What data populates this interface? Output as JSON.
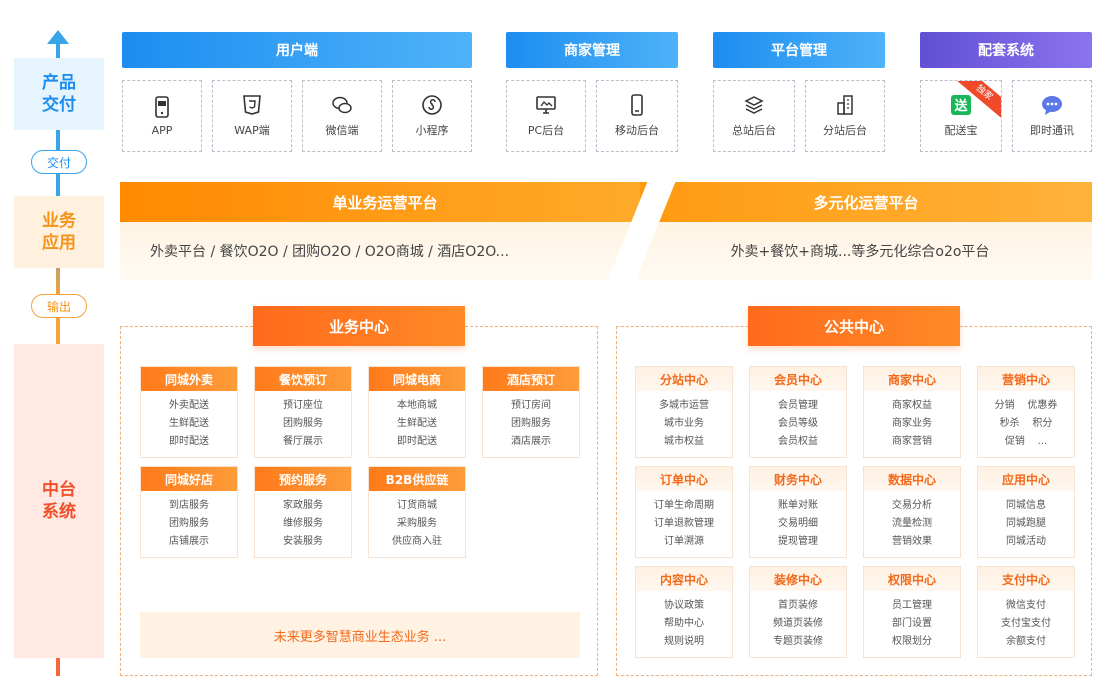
{
  "axis": {
    "product_delivery": [
      "产品",
      "交付"
    ],
    "deliver_pill": "交付",
    "business_app": [
      "业务",
      "应用"
    ],
    "output_pill": "输出",
    "middle_platform": [
      "中台",
      "系统"
    ]
  },
  "product": {
    "groups": [
      {
        "title": "用户端",
        "items": [
          {
            "label": "APP",
            "icon": "app-icon"
          },
          {
            "label": "WAP端",
            "icon": "html5-icon"
          },
          {
            "label": "微信端",
            "icon": "wechat-icon"
          },
          {
            "label": "小程序",
            "icon": "mini-program-icon"
          }
        ]
      },
      {
        "title": "商家管理",
        "items": [
          {
            "label": "PC后台",
            "icon": "monitor-icon"
          },
          {
            "label": "移动后台",
            "icon": "mobile-icon"
          }
        ]
      },
      {
        "title": "平台管理",
        "items": [
          {
            "label": "总站后台",
            "icon": "layers-icon"
          },
          {
            "label": "分站后台",
            "icon": "building-icon"
          }
        ]
      },
      {
        "title": "配套系统",
        "items": [
          {
            "label": "配送宝",
            "icon": "delivery-icon"
          },
          {
            "label": "即时通讯",
            "icon": "chat-icon"
          }
        ],
        "badge": "独家"
      }
    ]
  },
  "business": {
    "single_title": "单业务运营平台",
    "single_items": "外卖平台  /  餐饮O2O  /  团购O2O  /  O2O商城  /  酒店O2O...",
    "multi_title": "多元化运营平台",
    "multi_desc": "外卖+餐饮+商城...等多元化综合o2o平台"
  },
  "biz_center": {
    "title": "业务中心",
    "cards": [
      {
        "title": "同城外卖",
        "items": [
          "外卖配送",
          "生鲜配送",
          "即时配送"
        ]
      },
      {
        "title": "餐饮预订",
        "items": [
          "预订座位",
          "团购服务",
          "餐厅展示"
        ]
      },
      {
        "title": "同城电商",
        "items": [
          "本地商城",
          "生鲜配送",
          "即时配送"
        ]
      },
      {
        "title": "酒店预订",
        "items": [
          "预订房间",
          "团购服务",
          "酒店展示"
        ]
      },
      {
        "title": "同城好店",
        "items": [
          "到店服务",
          "团购服务",
          "店铺展示"
        ]
      },
      {
        "title": "预约服务",
        "items": [
          "家政服务",
          "维修服务",
          "安装服务"
        ]
      },
      {
        "title": "B2B供应链",
        "items": [
          "订货商城",
          "采购服务",
          "供应商入驻"
        ]
      }
    ],
    "future": "未来更多智慧商业生态业务 ..."
  },
  "pub_center": {
    "title": "公共中心",
    "cards": [
      {
        "title": "分站中心",
        "items": [
          "多城市运营",
          "城市业务",
          "城市权益"
        ]
      },
      {
        "title": "会员中心",
        "items": [
          "会员管理",
          "会员等级",
          "会员权益"
        ]
      },
      {
        "title": "商家中心",
        "items": [
          "商家权益",
          "商家业务",
          "商家营销"
        ]
      },
      {
        "title": "营销中心",
        "items": [
          "分销    优惠券",
          "秒杀    积分",
          "促销    ..."
        ]
      },
      {
        "title": "订单中心",
        "items": [
          "订单生命周期",
          "订单退款管理",
          "订单溯源"
        ]
      },
      {
        "title": "财务中心",
        "items": [
          "账单对账",
          "交易明细",
          "提现管理"
        ]
      },
      {
        "title": "数据中心",
        "items": [
          "交易分析",
          "流量检测",
          "营销效果"
        ]
      },
      {
        "title": "应用中心",
        "items": [
          "同城信息",
          "同城跑腿",
          "同城活动"
        ]
      },
      {
        "title": "内容中心",
        "items": [
          "协议政策",
          "帮助中心",
          "规则说明"
        ]
      },
      {
        "title": "装修中心",
        "items": [
          "首页装修",
          "频道页装修",
          "专题页装修"
        ]
      },
      {
        "title": "权限中心",
        "items": [
          "员工管理",
          "部门设置",
          "权限划分"
        ]
      },
      {
        "title": "支付中心",
        "items": [
          "微信支付",
          "支付宝支付",
          "余额支付"
        ]
      }
    ]
  },
  "colors": {
    "blue": "#1d8df0",
    "orange": "#ff8a00",
    "red_orange": "#ff6a1c",
    "purple": "#6150d4"
  }
}
